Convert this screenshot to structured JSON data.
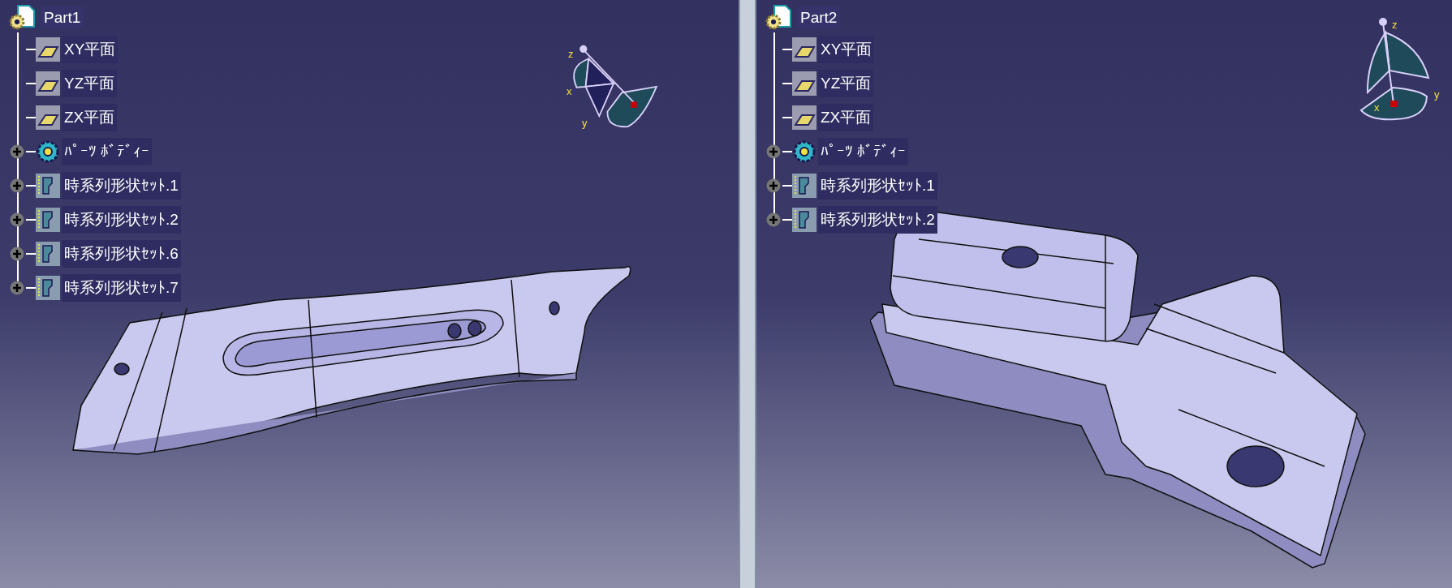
{
  "viewports": [
    {
      "tree": {
        "label": "Part1",
        "children": [
          {
            "label": "XY平面",
            "kind": "plane",
            "expandable": false
          },
          {
            "label": "YZ平面",
            "kind": "plane",
            "expandable": false
          },
          {
            "label": "ZX平面",
            "kind": "plane",
            "expandable": false
          },
          {
            "label": "ﾊﾟｰﾂ ﾎﾞﾃﾞｨｰ",
            "kind": "body",
            "expandable": true
          },
          {
            "label": "時系列形状ｾｯﾄ.1",
            "kind": "geoset",
            "expandable": true
          },
          {
            "label": "時系列形状ｾｯﾄ.2",
            "kind": "geoset",
            "expandable": true
          },
          {
            "label": "時系列形状ｾｯﾄ.6",
            "kind": "geoset",
            "expandable": true
          },
          {
            "label": "時系列形状ｾｯﾄ.7",
            "kind": "geoset",
            "expandable": true
          }
        ]
      },
      "compass": {
        "x": "x",
        "y": "y",
        "z": "z"
      },
      "part": {
        "kind": "plate"
      }
    },
    {
      "tree": {
        "label": "Part2",
        "children": [
          {
            "label": "XY平面",
            "kind": "plane",
            "expandable": false
          },
          {
            "label": "YZ平面",
            "kind": "plane",
            "expandable": false
          },
          {
            "label": "ZX平面",
            "kind": "plane",
            "expandable": false
          },
          {
            "label": "ﾊﾟｰﾂ ﾎﾞﾃﾞｨｰ",
            "kind": "body",
            "expandable": true
          },
          {
            "label": "時系列形状ｾｯﾄ.1",
            "kind": "geoset",
            "expandable": true
          },
          {
            "label": "時系列形状ｾｯﾄ.2",
            "kind": "geoset",
            "expandable": true
          }
        ]
      },
      "compass": {
        "x": "x",
        "y": "y",
        "z": "z"
      },
      "part": {
        "kind": "bracket"
      }
    }
  ]
}
